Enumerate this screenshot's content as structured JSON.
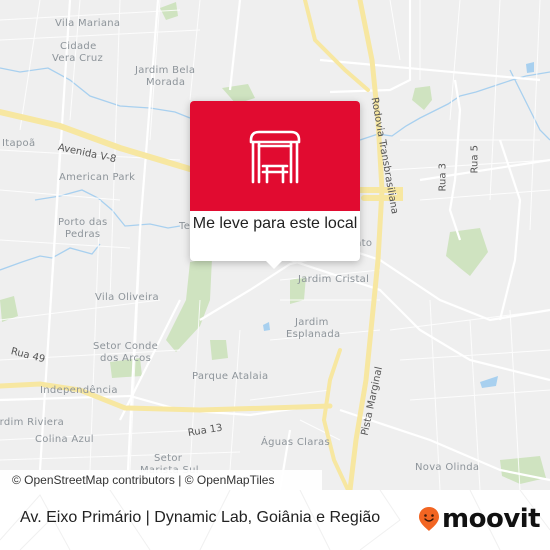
{
  "map": {
    "place_labels": [
      {
        "id": "vila-mariana",
        "text": "Vila Mariana"
      },
      {
        "id": "cidade-vera-cruz-1",
        "text": "Cidade"
      },
      {
        "id": "cidade-vera-cruz-2",
        "text": "Vera Cruz"
      },
      {
        "id": "jardim-bela-morada-1",
        "text": "Jardim Bela"
      },
      {
        "id": "jardim-bela-morada-2",
        "text": "Morada"
      },
      {
        "id": "itapoa",
        "text": "Itapoã"
      },
      {
        "id": "american-park",
        "text": "American Park"
      },
      {
        "id": "porto-das-pedras-1",
        "text": "Porto das"
      },
      {
        "id": "porto-das-pedras-2",
        "text": "Pedras"
      },
      {
        "id": "te",
        "text": "Te"
      },
      {
        "id": "nto",
        "text": "nto"
      },
      {
        "id": "jardim-cristal",
        "text": "Jardim Cristal"
      },
      {
        "id": "vila-oliveira",
        "text": "Vila Oliveira"
      },
      {
        "id": "jardim-esplanada-1",
        "text": "Jardim"
      },
      {
        "id": "jardim-esplanada-2",
        "text": "Esplanada"
      },
      {
        "id": "setor-conde-dos-arcos-1",
        "text": "Setor Conde"
      },
      {
        "id": "setor-conde-dos-arcos-2",
        "text": "dos Arcos"
      },
      {
        "id": "parque-atalaia",
        "text": "Parque Atalaia"
      },
      {
        "id": "independencia",
        "text": "Independência"
      },
      {
        "id": "jardim-riviera",
        "text": "Jardim Riviera"
      },
      {
        "id": "colina-azul",
        "text": "Colina Azul"
      },
      {
        "id": "aguas-claras",
        "text": "Águas Claras"
      },
      {
        "id": "setor-marista-sul-1",
        "text": "Setor"
      },
      {
        "id": "setor-marista-sul-2",
        "text": "Marista Sul"
      },
      {
        "id": "nova-olinda",
        "text": "Nova Olinda"
      }
    ],
    "road_labels": [
      {
        "id": "avenida-v8",
        "text": "Avenida V-8"
      },
      {
        "id": "rodovia-transbrasiliana",
        "text": "Rodovia Transbrasiliana"
      },
      {
        "id": "rua-3",
        "text": "Rua 3"
      },
      {
        "id": "rua-5",
        "text": "Rua 5"
      },
      {
        "id": "rua-49",
        "text": "Rua 49"
      },
      {
        "id": "rua-13",
        "text": "Rua 13"
      },
      {
        "id": "pista-marginal",
        "text": "Pista Marginal"
      }
    ],
    "attribution": {
      "osm": "© OpenStreetMap contributors",
      "separator": " | ",
      "omt": "© OpenMapTiles"
    },
    "colors": {
      "background": "#efefef",
      "major_road": "#f7e7a1",
      "minor_road": "#ffffff",
      "park": "#cfe3c0",
      "water": "#a8d0ef"
    }
  },
  "popup": {
    "icon": "bus-stop-shelter-icon",
    "action_label": "Me leve para este local",
    "header_color": "#e10b30"
  },
  "footer": {
    "title": "Av. Eixo Primário | Dynamic Lab, Goiânia e Região",
    "brand": {
      "icon": "moovit-pin-icon",
      "name": "moovit",
      "pin_color": "#f26522"
    }
  }
}
